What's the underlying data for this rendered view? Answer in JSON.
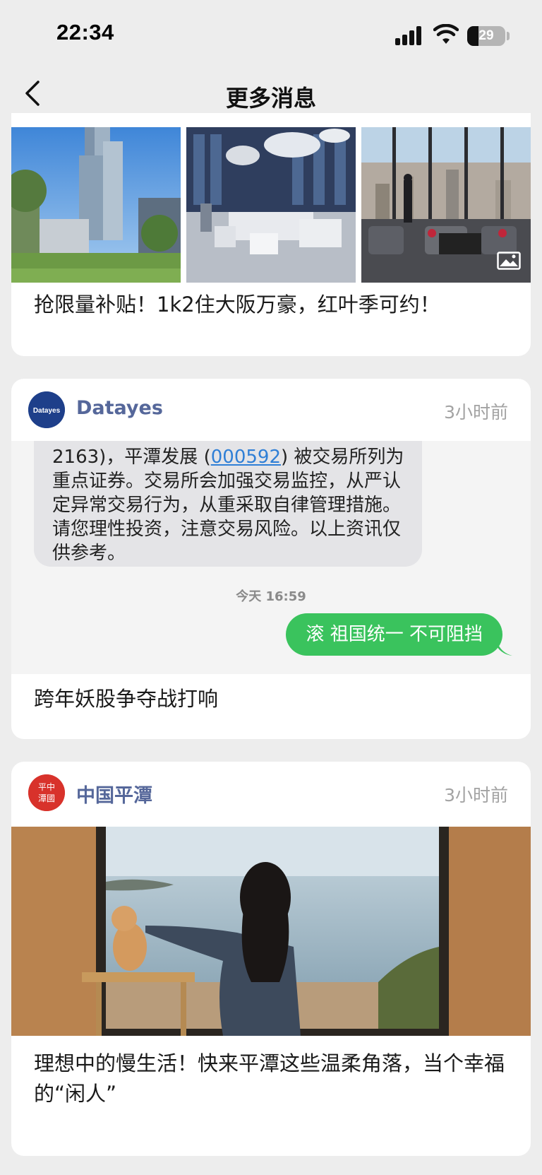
{
  "status_bar": {
    "time": "22:34",
    "battery_level": "29",
    "battery_fraction": 0.29
  },
  "nav": {
    "title": "更多消息"
  },
  "cards": [
    {
      "title": "抢限量补贴！1k2住大阪万豪，红叶季可约！",
      "images": [
        "tower-exterior-photo",
        "hotel-lobby-photo",
        "lounge-city-view-photo"
      ]
    },
    {
      "source": "Datayes",
      "avatar_text": "Datayes",
      "time": "3小时前",
      "chat": {
        "incoming_pre": "2163)，平潭发展 (",
        "incoming_link": "000592",
        "incoming_post": ") 被交易所列为重点证券。交易所会加强交易监控，从严认定异常交易行为，从重采取自律管理措施。请您理性投资，注意交易风险。以上资讯仅供参考。",
        "timestamp": "今天 16:59",
        "outgoing": "滚 祖国统一 不可阻挡"
      },
      "title": "跨年妖股争夺战打响"
    },
    {
      "source": "中国平潭",
      "avatar_text": "平中潭國",
      "time": "3小时前",
      "title": "理想中的慢生活！快来平潭这些温柔角落，当个幸福的“闲人”"
    }
  ],
  "colors": {
    "background": "#ededed",
    "source_name": "#55679a",
    "timestamp": "#a3a3a3",
    "chat_green": "#3ac35d",
    "link_blue": "#2f7fd6"
  }
}
